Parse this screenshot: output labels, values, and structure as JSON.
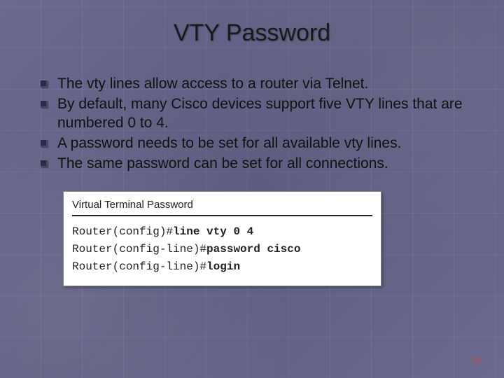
{
  "title": "VTY Password",
  "bullets": [
    "The vty lines allow access to a router via Telnet.",
    "By default, many Cisco devices support five VTY lines that are numbered 0 to 4.",
    "A password needs to be set for all available vty lines.",
    "The same password can be set for all connections."
  ],
  "terminal": {
    "heading": "Virtual Terminal Password",
    "lines": [
      {
        "prompt": "Router(config)#",
        "command": "line vty 0 4"
      },
      {
        "prompt": "Router(config-line)#",
        "command": "password cisco"
      },
      {
        "prompt": "Router(config-line)#",
        "command": "login"
      }
    ]
  },
  "page_number": "33"
}
